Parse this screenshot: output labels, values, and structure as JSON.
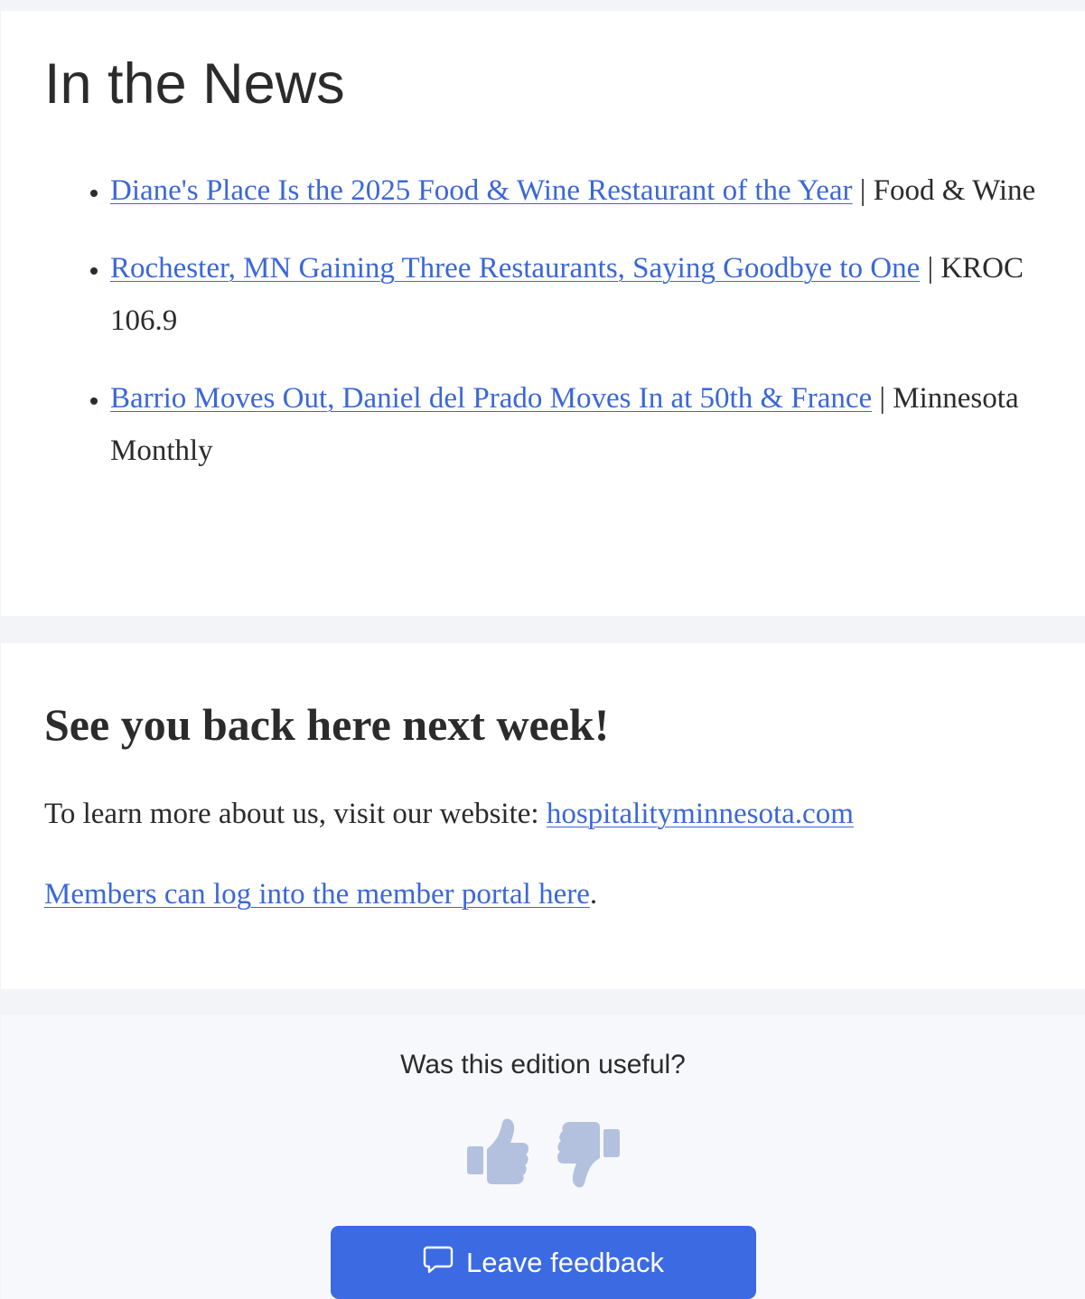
{
  "news": {
    "heading": "In the News",
    "items": [
      {
        "link_text": "Diane's Place Is the 2025 Food & Wine Restaurant of the Year",
        "source": " | Food & Wine"
      },
      {
        "link_text": "Rochester, MN Gaining Three Restaurants, Saying Goodbye to One",
        "source": " | KROC 106.9"
      },
      {
        "link_text": "Barrio Moves Out, Daniel del Prado Moves In at 50th & France",
        "source": " | Minnesota Monthly"
      }
    ]
  },
  "signoff": {
    "heading": "See you back here next week!",
    "website_prefix": "To learn more about us, visit our website: ",
    "website_link": "hospitalityminnesota.com",
    "portal_link": "Members can log into the member portal here",
    "portal_suffix": "."
  },
  "feedback": {
    "question": "Was this edition useful?",
    "button_label": "Leave feedback",
    "icons": {
      "thumbs_up": "thumbs-up-icon",
      "thumbs_down": "thumbs-down-icon",
      "comment": "comment-icon"
    }
  },
  "colors": {
    "page_background": "#f3f4f8",
    "card_background": "#ffffff",
    "link": "#3b67d8",
    "button": "#3b6ae3",
    "thumb_icon": "#b3c1de",
    "text": "#2b2b2b"
  }
}
